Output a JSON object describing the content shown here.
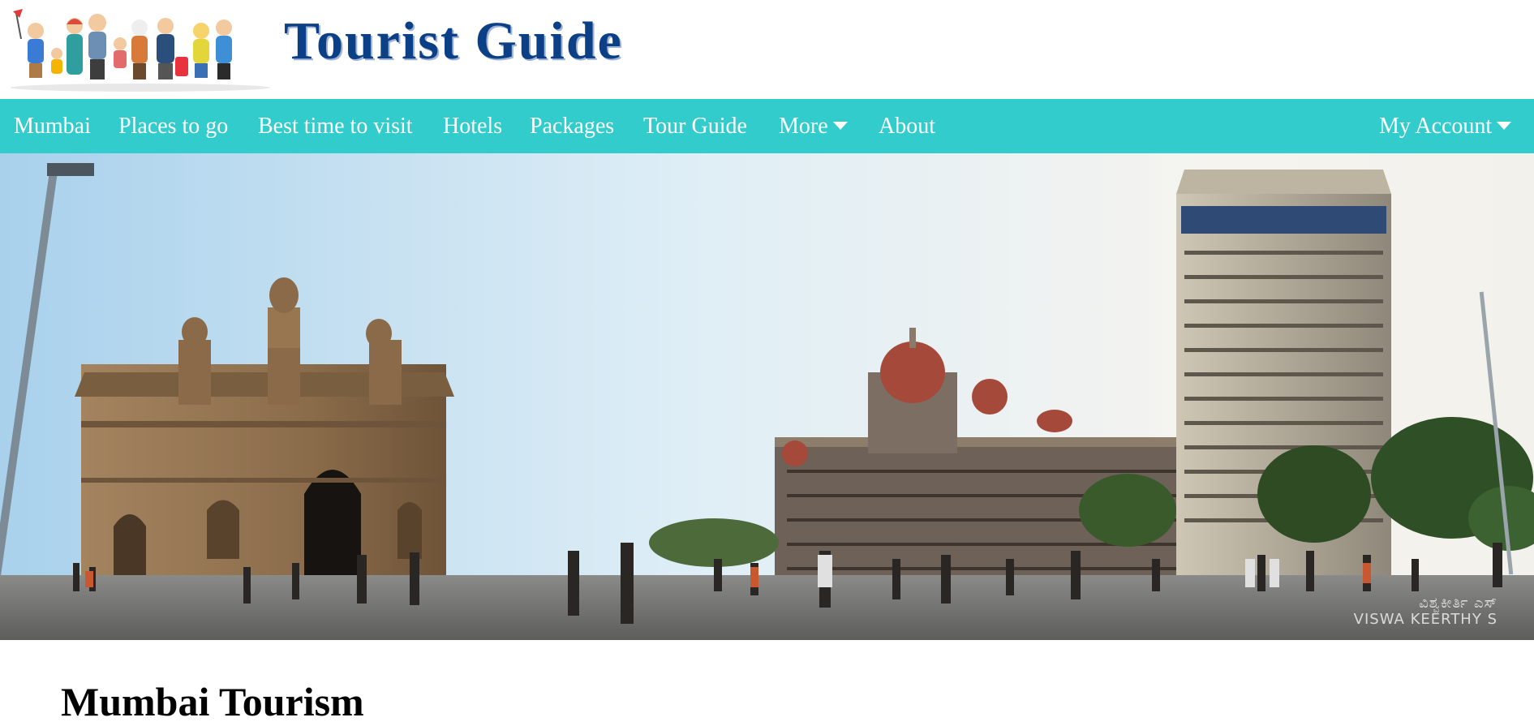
{
  "header": {
    "logo_text": "Tourist Guide"
  },
  "nav": {
    "items": [
      "Mumbai",
      "Places to go",
      "Best time to visit",
      "Hotels",
      "Packages",
      "Tour Guide"
    ],
    "more_label": "More",
    "about_label": "About",
    "account_label": "My Account"
  },
  "hero": {
    "watermark_line1": "ವಿಶ್ವಕೀರ್ತಿ ಎಸ್",
    "watermark_line2": "VISWA KEERTHY S"
  },
  "main": {
    "title": "Mumbai Tourism"
  },
  "colors": {
    "nav_bg": "#33cccc",
    "logo_blue": "#0b3f86",
    "nav_text": "#ffffff"
  },
  "icons": {
    "more_caret": "caret-down-icon",
    "account_caret": "caret-down-icon"
  }
}
